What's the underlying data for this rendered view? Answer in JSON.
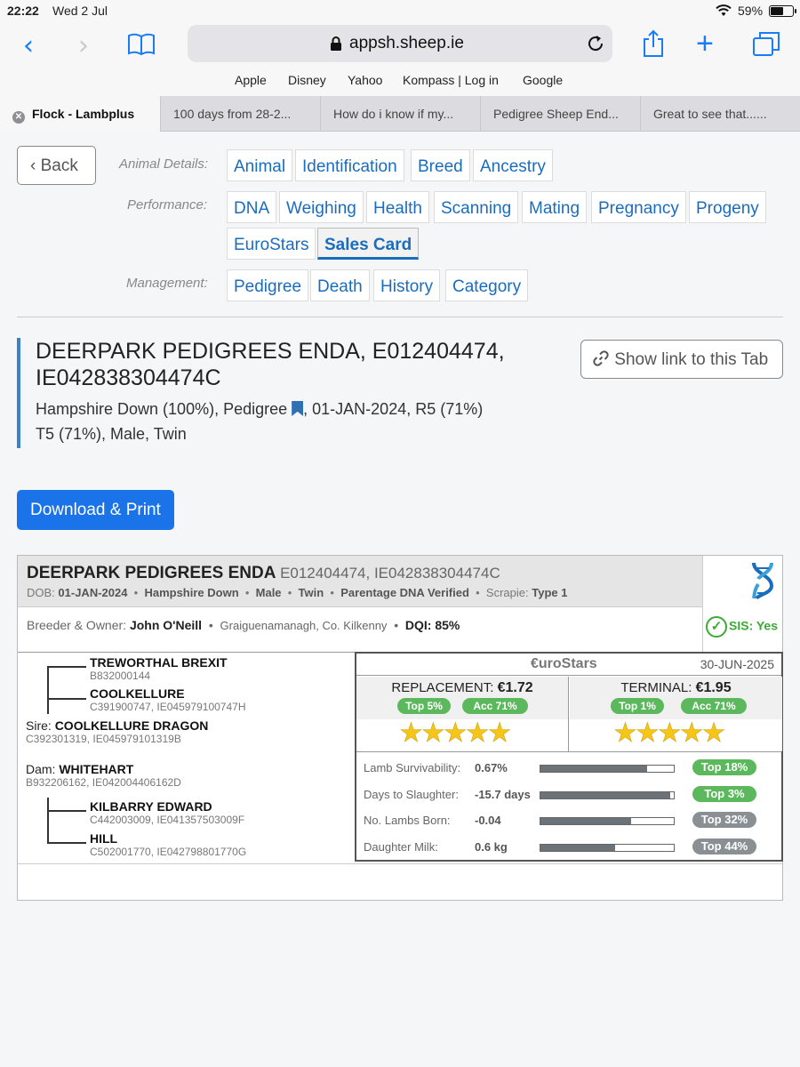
{
  "status_bar": {
    "time": "22:22",
    "date": "Wed 2 Jul",
    "battery": "59%",
    "battery_level": 0.59
  },
  "browser": {
    "url": "appsh.sheep.ie",
    "favorites": [
      "Apple",
      "Disney",
      "Yahoo",
      "Kompass | Log in",
      "Google"
    ],
    "tabs": [
      {
        "label": "Flock - Lambplus",
        "active": true
      },
      {
        "label": "100 days from 28-2...",
        "active": false
      },
      {
        "label": "How do i know if my...",
        "active": false
      },
      {
        "label": "Pedigree Sheep End...",
        "active": false
      },
      {
        "label": "Great to see that......",
        "active": false
      }
    ]
  },
  "nav": {
    "back_label": "Back",
    "animal_details_label": "Animal Details:",
    "performance_label": "Performance:",
    "management_label": "Management:",
    "animal_details": [
      "Animal",
      "Identification",
      "Breed",
      "Ancestry"
    ],
    "performance": [
      "DNA",
      "Weighing",
      "Health",
      "Scanning",
      "Mating",
      "Pregnancy",
      "Progeny",
      "EuroStars",
      "Sales Card"
    ],
    "management": [
      "Pedigree",
      "Death",
      "History",
      "Category"
    ],
    "selected": "Sales Card"
  },
  "animal": {
    "name_line1": "DEERPARK PEDIGREES ENDA, E012404474,",
    "name_line2": "IE042838304474C",
    "meta_a": "Hampshire Down (100%), Pedigree",
    "meta_b": ", 01-JAN-2024, R5 (71%)",
    "meta_line2": "T5 (71%), Male, Twin",
    "show_link_label": "Show link to this Tab"
  },
  "download_label": "Download & Print",
  "sales_card": {
    "name": "DEERPARK PEDIGREES ENDA",
    "ids": "E012404474, IE042838304474C",
    "dob_label": "DOB: ",
    "dob": "01-JAN-2024",
    "breed": "Hampshire Down",
    "sex": "Male",
    "birth_type": "Twin",
    "parentage": "Parentage DNA Verified",
    "scrapie_label": "Scrapie: ",
    "scrapie": "Type 1",
    "breeder_label": "Breeder & Owner: ",
    "breeder": "John O'Neill",
    "location": "Graiguenamanagh, Co. Kilkenny",
    "dqi": "DQI: 85%",
    "sis": "SIS: Yes",
    "pedigree": {
      "sire_sire": {
        "name": "TREWORTHAL BREXIT",
        "ids": "B832000144"
      },
      "sire_dam": {
        "name": "COOLKELLURE",
        "ids": "C391900747, IE045979100747H"
      },
      "sire_label": "Sire: ",
      "sire": {
        "name": "COOLKELLURE DRAGON",
        "ids": "C392301319, IE045979101319B"
      },
      "dam_label": "Dam: ",
      "dam": {
        "name": "WHITEHART",
        "ids": "B932206162, IE042004406162D"
      },
      "dam_sire": {
        "name": "KILBARRY EDWARD",
        "ids": "C442003009, IE041357503009F"
      },
      "dam_dam": {
        "name": "HILL",
        "ids": "C502001770, IE042798801770G"
      }
    },
    "eurostars": {
      "title": "€uroStars",
      "date": "30-JUN-2025",
      "replacement": {
        "label": "REPLACEMENT: ",
        "value": "€1.72",
        "top": "Top 5%",
        "acc": "Acc 71%",
        "stars": 5
      },
      "terminal": {
        "label": "TERMINAL: ",
        "value": "€1.95",
        "top": "Top 1%",
        "acc": "Acc 71%",
        "stars": 5
      },
      "traits": [
        {
          "label": "Lamb Survivability:",
          "value": "0.67%",
          "bar": 0.8,
          "top": "Top 18%",
          "color": "#5cb85c"
        },
        {
          "label": "Days to Slaughter:",
          "value": "-15.7 days",
          "bar": 0.97,
          "top": "Top 3%",
          "color": "#5cb85c"
        },
        {
          "label": "No. Lambs Born:",
          "value": "-0.04",
          "bar": 0.68,
          "top": "Top 32%",
          "color": "#8a8f94"
        },
        {
          "label": "Daughter Milk:",
          "value": "0.6 kg",
          "bar": 0.56,
          "top": "Top 44%",
          "color": "#8a8f94"
        }
      ]
    }
  },
  "colors": {
    "accent": "#1a73e8",
    "link": "#1a6cbd",
    "good": "#5cb85c",
    "star": "#f5c518"
  }
}
